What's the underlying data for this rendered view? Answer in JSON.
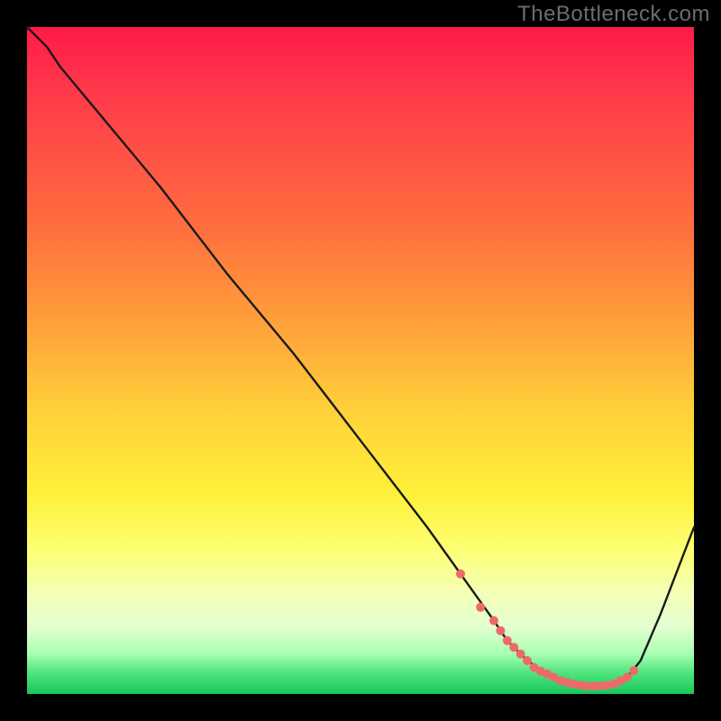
{
  "watermark": "TheBottleneck.com",
  "colors": {
    "background": "#000000",
    "watermark": "#6d6d6d",
    "curve": "#1a1a1a",
    "dots": "#ee6a6a"
  },
  "chart_data": {
    "type": "line",
    "title": "",
    "xlabel": "",
    "ylabel": "",
    "xlim": [
      0,
      100
    ],
    "ylim": [
      0,
      100
    ],
    "grid": false,
    "legend": false,
    "gradient_background": {
      "top": "#ff1a47",
      "middle": "#ffe03a",
      "bottom": "#18c85a"
    },
    "series": [
      {
        "name": "bottleneck-curve",
        "x": [
          0,
          3,
          5,
          10,
          20,
          30,
          40,
          50,
          60,
          65,
          70,
          72,
          75,
          78,
          80,
          82,
          84,
          86,
          88,
          90,
          92,
          95,
          100
        ],
        "y": [
          100,
          97,
          94,
          88,
          76,
          63,
          51,
          38,
          25,
          18,
          11,
          8,
          5,
          3,
          2,
          1.5,
          1.2,
          1.2,
          1.5,
          2.5,
          5,
          12,
          25
        ]
      }
    ],
    "highlight_points": {
      "name": "optimal-region-dots",
      "x": [
        65,
        68,
        70,
        71,
        72,
        73,
        74,
        75,
        76,
        77,
        78,
        79,
        80,
        81,
        82,
        83,
        84,
        85,
        86,
        87,
        88,
        89,
        90,
        91
      ],
      "y": [
        18,
        13,
        11,
        9.5,
        8,
        7,
        6,
        5,
        4,
        3.4,
        3,
        2.5,
        2,
        1.7,
        1.5,
        1.3,
        1.2,
        1.2,
        1.2,
        1.3,
        1.5,
        2,
        2.5,
        3.5
      ]
    }
  }
}
